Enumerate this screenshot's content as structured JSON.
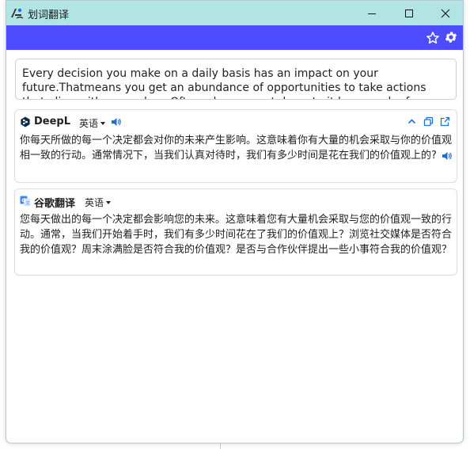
{
  "window": {
    "title": "划词翻译"
  },
  "source": {
    "text": "Every decision you make on a daily basis has an impact on your future.Thatmeans you get an abundance of opportunities to take actions that align with yourvalues.Often when we get down to it,how much of our time is"
  },
  "deepl": {
    "name": "DeepL",
    "lang": "英语",
    "text": "你每天所做的每一个决定都会对你的未来产生影响。这意味着你有大量的机会采取与你的价值观相一致的行动。通常情况下，当我们认真对待时，我们有多少时间是花在我们的价值观上的?"
  },
  "google": {
    "name": "谷歌翻译",
    "lang": "英语",
    "text": "您每天做出的每一个决定都会影响您的未来。这意味着您有大量机会采取与您的价值观一致的行动。通常，当我们开始着手时，我们有多少时间花在了我们的价值观上？浏览社交媒体是否符合我的价值观？周末涂满脸是否符合我的价值观？是否与合作伙伴提出一些小事符合我的价值观？"
  },
  "colors": {
    "titlebar": "#b2e4e4",
    "toolbar": "#4d4dff",
    "accent": "#1e6fd9"
  },
  "icons": [
    "app-logo-icon",
    "minimize-icon",
    "maximize-icon",
    "close-icon",
    "star-icon",
    "gear-icon",
    "deepl-logo-icon",
    "google-translate-icon",
    "speaker-icon",
    "collapse-icon",
    "copy-icon",
    "open-external-icon"
  ]
}
